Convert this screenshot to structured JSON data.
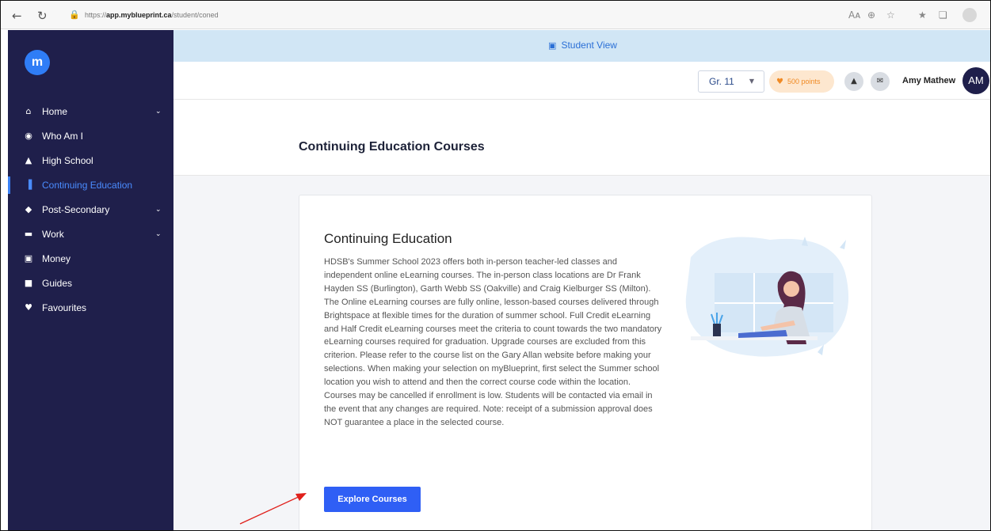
{
  "browser": {
    "url_scheme": "https://",
    "url_host": "app.myblueprint.ca",
    "url_path": "/student/coned",
    "read_aloud_label": "Aᴀ"
  },
  "sidebar": {
    "logo_text": "m",
    "items": [
      {
        "label": "Home",
        "icon": "home-icon",
        "glyph": "⌂",
        "has_chevron": true
      },
      {
        "label": "Who Am I",
        "icon": "user-circle-icon",
        "glyph": "◉"
      },
      {
        "label": "High School",
        "icon": "school-icon",
        "glyph": "▲"
      },
      {
        "label": "Continuing Education",
        "icon": "books-icon",
        "glyph": "▐",
        "active": true
      },
      {
        "label": "Post-Secondary",
        "icon": "graduation-cap-icon",
        "glyph": "◆",
        "has_chevron": true
      },
      {
        "label": "Work",
        "icon": "briefcase-icon",
        "glyph": "▬",
        "has_chevron": true
      },
      {
        "label": "Money",
        "icon": "money-icon",
        "glyph": "▣"
      },
      {
        "label": "Guides",
        "icon": "guides-icon",
        "glyph": "■"
      },
      {
        "label": "Favourites",
        "icon": "heart-icon",
        "glyph": "♥"
      }
    ],
    "chevron_glyph": "⌄"
  },
  "banner": {
    "label": "Student View"
  },
  "header": {
    "grade": "Gr. 11",
    "points": "500 points",
    "user_name": "Amy Mathew",
    "avatar_initials": "AM"
  },
  "page": {
    "title": "Continuing Education Courses"
  },
  "card": {
    "title": "Continuing Education",
    "body": "HDSB's Summer School 2023 offers both in-person teacher-led classes and independent online eLearning courses. The in-person class locations are Dr Frank Hayden SS (Burlington), Garth Webb SS (Oakville) and Craig Kielburger SS (Milton). The Online eLearning courses are fully online, lesson-based courses delivered through Brightspace at flexible times for the duration of summer school. Full Credit eLearning and Half Credit eLearning courses meet the criteria to count towards the two mandatory eLearning courses required for graduation. Upgrade courses are excluded from this criterion. Please refer to the course list on the Gary Allan website before making your selections. When making your selection on myBlueprint, first select the Summer school location you wish to attend and then the correct course code within the location. Courses may be cancelled if enrollment is low. Students will be contacted via email in the event that any changes are required. Note: receipt of a submission approval does NOT guarantee a place in the selected course.",
    "button_label": "Explore Courses"
  },
  "colors": {
    "sidebar_bg": "#1f1f4b",
    "accent": "#2f5ff5",
    "banner_bg": "#d1e6f5",
    "active_nav": "#4a8cff",
    "points_bg": "#fde7cf",
    "points_text": "#f08a24",
    "annotation_arrow": "#e0201b"
  }
}
